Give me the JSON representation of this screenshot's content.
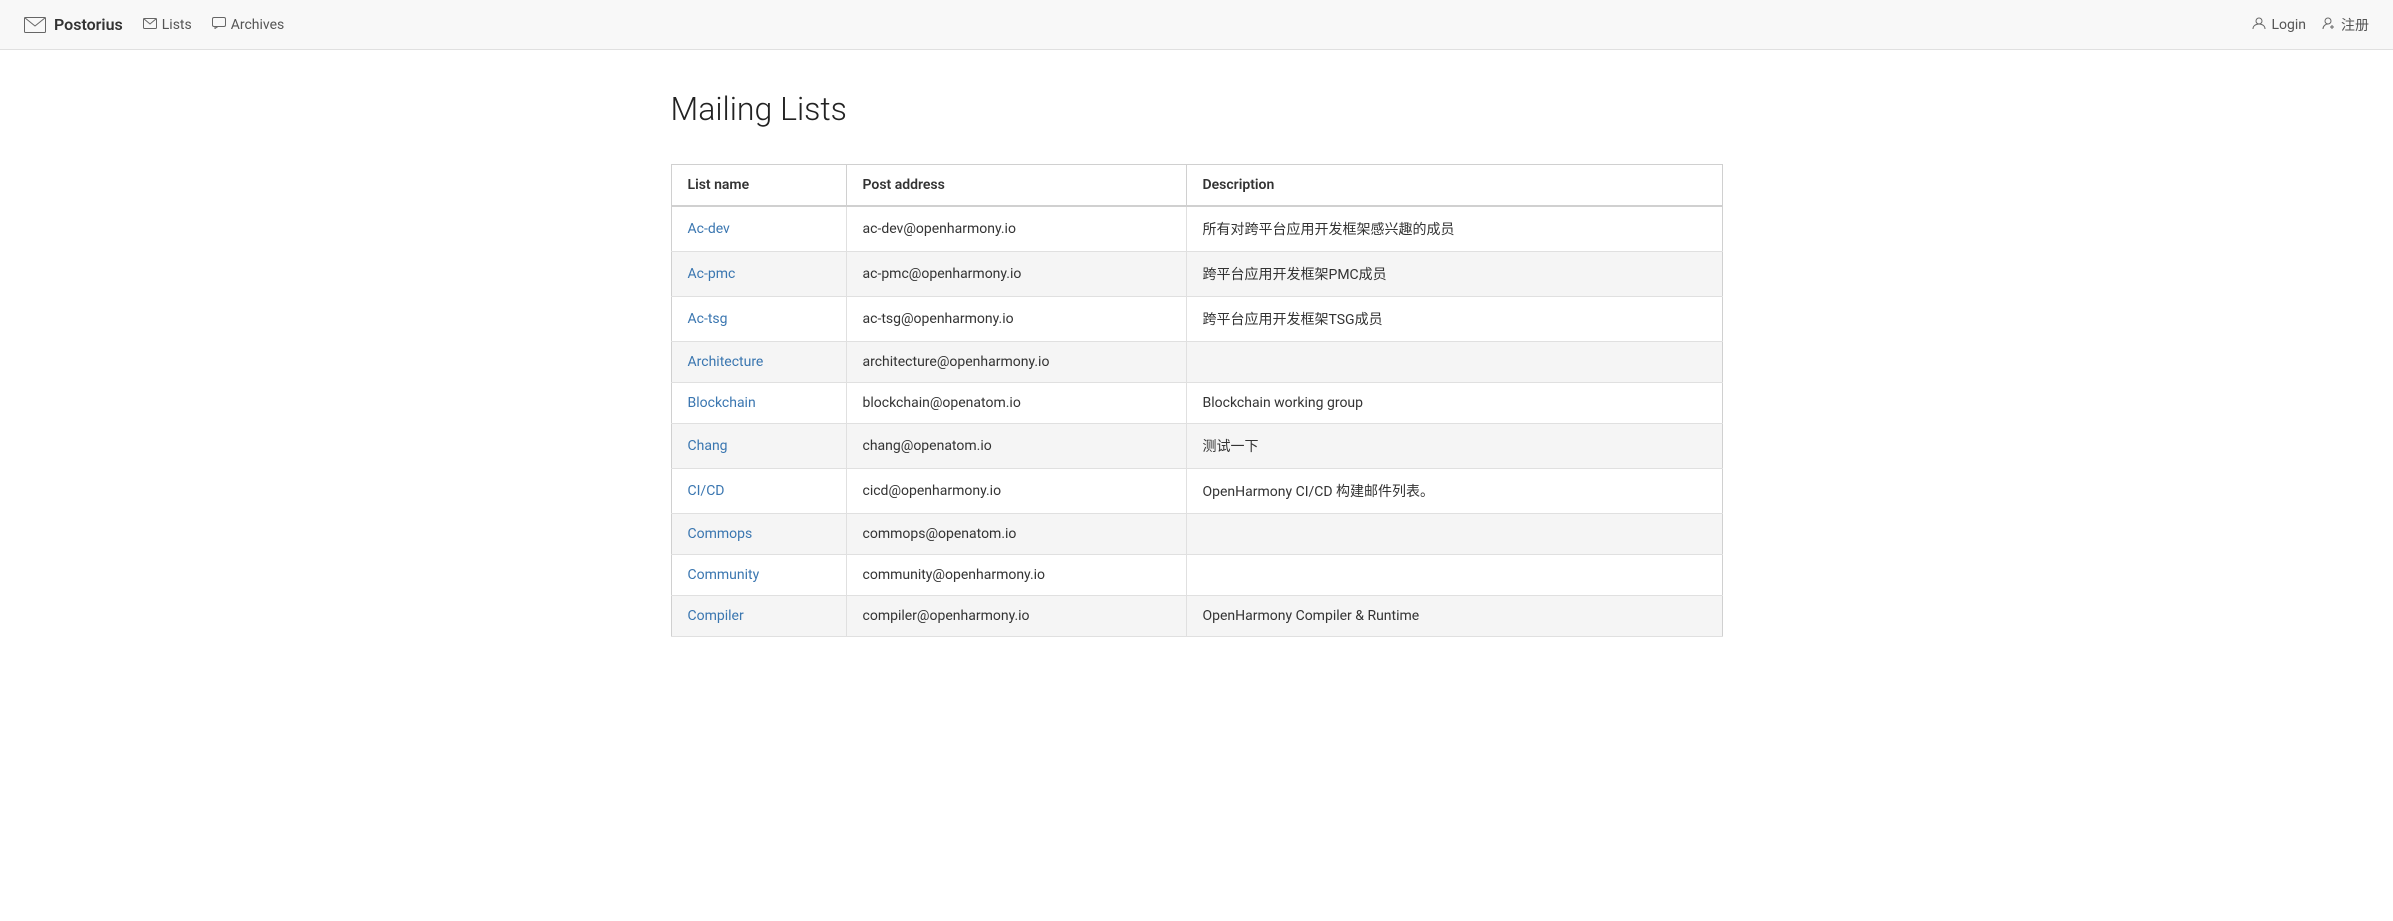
{
  "brand": {
    "name": "Postorius",
    "icon": "✉"
  },
  "nav": {
    "lists_label": "Lists",
    "archives_label": "Archives",
    "login_label": "Login",
    "register_label": "注册"
  },
  "page": {
    "title": "Mailing Lists"
  },
  "table": {
    "headers": {
      "list_name": "List name",
      "post_address": "Post address",
      "description": "Description"
    },
    "rows": [
      {
        "list_name": "Ac-dev",
        "post_address": "ac-dev@openharmony.io",
        "description": "所有对跨平台应用开发框架感兴趣的成员"
      },
      {
        "list_name": "Ac-pmc",
        "post_address": "ac-pmc@openharmony.io",
        "description": "跨平台应用开发框架PMC成员"
      },
      {
        "list_name": "Ac-tsg",
        "post_address": "ac-tsg@openharmony.io",
        "description": "跨平台应用开发框架TSG成员"
      },
      {
        "list_name": "Architecture",
        "post_address": "architecture@openharmony.io",
        "description": ""
      },
      {
        "list_name": "Blockchain",
        "post_address": "blockchain@openatom.io",
        "description": "Blockchain working group"
      },
      {
        "list_name": "Chang",
        "post_address": "chang@openatom.io",
        "description": "测试一下"
      },
      {
        "list_name": "CI/CD",
        "post_address": "cicd@openharmony.io",
        "description": "OpenHarmony CI/CD 构建邮件列表。"
      },
      {
        "list_name": "Commops",
        "post_address": "commops@openatom.io",
        "description": ""
      },
      {
        "list_name": "Community",
        "post_address": "community@openharmony.io",
        "description": ""
      },
      {
        "list_name": "Compiler",
        "post_address": "compiler@openharmony.io",
        "description": "OpenHarmony Compiler & Runtime"
      }
    ]
  }
}
